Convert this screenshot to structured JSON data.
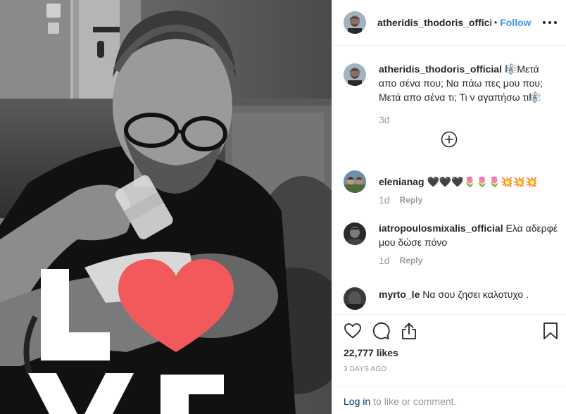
{
  "post": {
    "username": "atheridis_thodoris_official",
    "separator": "•",
    "follow_label": "Follow",
    "more_icon": "more-options-icon"
  },
  "caption": {
    "username": "atheridis_thodoris_official",
    "text": "🎼Μετά απο σένα που; Να πάω πες μου που; Μετά απο σένα τι; Τι ν αγαπήσω τι🎼",
    "time": "3d"
  },
  "comments": [
    {
      "username": "elenianag",
      "text": "🖤🖤🖤🌷🌷🌷💥💥💥",
      "time": "1d",
      "reply_label": "Reply"
    },
    {
      "username": "iatropoulosmixalis_official",
      "text": "Ελα αδερφέ μου δώσε πόνο",
      "time": "1d",
      "reply_label": "Reply"
    },
    {
      "username": "myrto_le",
      "text": "Να σου ζησει καλοτυχο .",
      "time": "",
      "reply_label": ""
    }
  ],
  "actions": {
    "likes": "22,777 likes",
    "timestamp": "3 DAYS AGO",
    "login_link": "Log in",
    "login_text": "to like or comment."
  },
  "photo": {
    "overlay_letters": [
      "L",
      "VE"
    ],
    "heart_color": "#f2595a"
  },
  "colors": {
    "link_blue": "#3897f0",
    "muted": "#999999",
    "border": "#efefef",
    "text": "#262626"
  }
}
